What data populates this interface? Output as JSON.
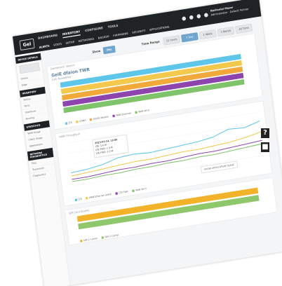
{
  "topbar": {
    "logo": "Gel",
    "nav": [
      {
        "label": "DASHBOARD",
        "active": false
      },
      {
        "label": "INVENTORY",
        "active": true
      },
      {
        "label": "CONFIGURE",
        "active": false
      },
      {
        "label": "TOOLS",
        "active": false
      }
    ],
    "subnav": [
      {
        "label": "ALERTS",
        "active": true
      },
      {
        "label": "STATS",
        "active": false
      },
      {
        "label": "SETUP",
        "active": false
      },
      {
        "label": "NETWORKS",
        "active": false
      },
      {
        "label": "BACKUP",
        "active": false
      },
      {
        "label": "FIRMWARE",
        "active": false
      },
      {
        "label": "SECURITY",
        "active": false
      },
      {
        "label": "APPLICATIONS",
        "active": false
      }
    ],
    "user": {
      "name": "Nathaniel Moser",
      "role": "Administrator · Default Partner"
    }
  },
  "sidebar": {
    "sections": [
      {
        "title": "DEVICE DETAILS",
        "items": [
          "Online",
          "Edge"
        ]
      },
      {
        "title": "INVENTORY",
        "items": [
          "Status",
          "Ports",
          "Interfaces",
          "Routing"
        ]
      },
      {
        "title": "STATISTICS",
        "items": [
          "WAN Usage",
          "Client Usage",
          "Applications"
        ]
      },
      {
        "title": "NETWORK DIAGNOSTICS",
        "items": [
          "Ping",
          "Traceroute",
          "Diagnostics"
        ]
      }
    ]
  },
  "filters": {
    "show_label": "Show",
    "show_value": "Day",
    "time_range_label": "Time Range",
    "ranges": [
      {
        "label": "12 hours",
        "active": false
      },
      {
        "label": "1 Day",
        "active": true
      },
      {
        "label": "1 Week",
        "active": false
      },
      {
        "label": "1 Month",
        "active": false
      },
      {
        "label": "All Time",
        "active": false
      }
    ]
  },
  "panels": {
    "breadcrumb": "Dashboard / Device",
    "title": "GelE dfaion TWR",
    "availability": {
      "title": "Link Availability",
      "legend": [
        "LTE",
        "CDMA",
        "3G/4G Modem",
        "WAN Ethernet",
        "WAN Wi-Fi"
      ]
    },
    "throughput": {
      "title": "WAN Throughput",
      "show_application_usage": "SHOW APPLICATION USAGE",
      "tooltip": {
        "time": "2015-03-14, 12:00",
        "lines": [
          "LTE: 1.6 M",
          "LTE FWD: 1.0 M",
          "LTE FWD: 1.0 M"
        ]
      },
      "legend": [
        "LTE",
        "WAN Ethernet (eth0)",
        "LTE FWD",
        "WAN Wi-Fi"
      ]
    },
    "sim": {
      "title": "SIM Card Quality",
      "legend": [
        "GPRS",
        "LTE"
      ],
      "rows": [
        "SIM 1 Carrier",
        "SIM 2 Carrier"
      ]
    }
  },
  "chart_data": [
    {
      "type": "bar",
      "title": "Link Availability",
      "categories": [
        "LTE",
        "CDMA",
        "3G/4G Modem",
        "WAN Ethernet",
        "WAN Wi-Fi"
      ],
      "values": [
        100,
        100,
        100,
        100,
        100
      ],
      "colors": [
        "#5ec6e8",
        "#f2c94c",
        "#f2a93b",
        "#8e44ad",
        "#7fc36a"
      ]
    },
    {
      "type": "line",
      "title": "WAN Throughput",
      "x": [
        0,
        1,
        2,
        3,
        4,
        5,
        6,
        7,
        8,
        9,
        10,
        11,
        12
      ],
      "series": [
        {
          "name": "LTE",
          "color": "#5ec6e8",
          "values": [
            1.2,
            1.3,
            1.5,
            1.9,
            2.0,
            1.9,
            2.0,
            2.1,
            2.2,
            2.4,
            2.9,
            2.8,
            3.2
          ]
        },
        {
          "name": "WAN Ethernet (eth0)",
          "color": "#f2c94c",
          "values": [
            0.9,
            1.0,
            1.1,
            1.2,
            1.3,
            1.3,
            1.4,
            1.5,
            1.5,
            1.6,
            1.7,
            1.9,
            2.2
          ]
        },
        {
          "name": "LTE FWD",
          "color": "#8e44ad",
          "values": [
            0.6,
            0.6,
            0.7,
            0.8,
            0.8,
            0.9,
            0.9,
            1.0,
            1.1,
            1.1,
            1.2,
            1.3,
            1.4
          ]
        },
        {
          "name": "WAN Wi-Fi",
          "color": "#7fc36a",
          "values": [
            0.4,
            0.4,
            0.5,
            0.5,
            0.6,
            0.6,
            0.7,
            0.7,
            0.8,
            0.8,
            0.9,
            1.0,
            1.1
          ]
        }
      ],
      "ylim": [
        0,
        4
      ]
    },
    {
      "type": "bar",
      "title": "SIM Card Quality",
      "categories": [
        "SIM 1 Carrier",
        "SIM 2 Carrier"
      ],
      "values": [
        100,
        100
      ],
      "colors": [
        "#f2b32a",
        "#8fc76b"
      ]
    }
  ]
}
